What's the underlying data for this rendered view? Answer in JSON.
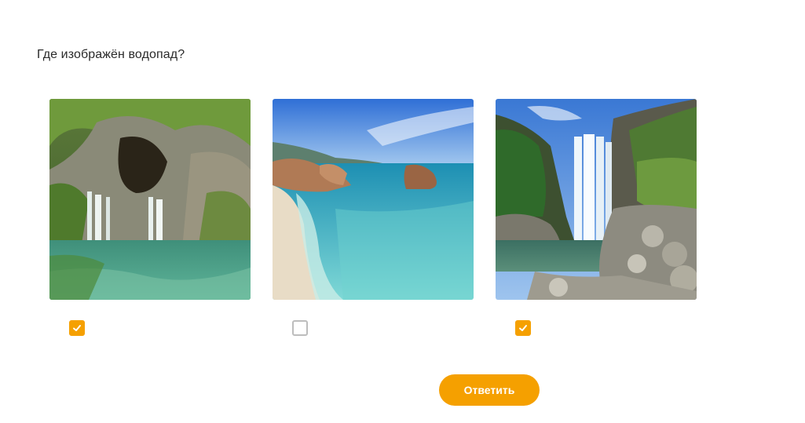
{
  "question": "Где изображён водопад?",
  "options": [
    {
      "image": "waterfall-grotto",
      "checked": true
    },
    {
      "image": "beach-sea",
      "checked": false
    },
    {
      "image": "tall-waterfall",
      "checked": true
    }
  ],
  "submit_label": "Ответить",
  "colors": {
    "accent": "#f5a000",
    "unchecked_border": "#bdbdbd"
  }
}
